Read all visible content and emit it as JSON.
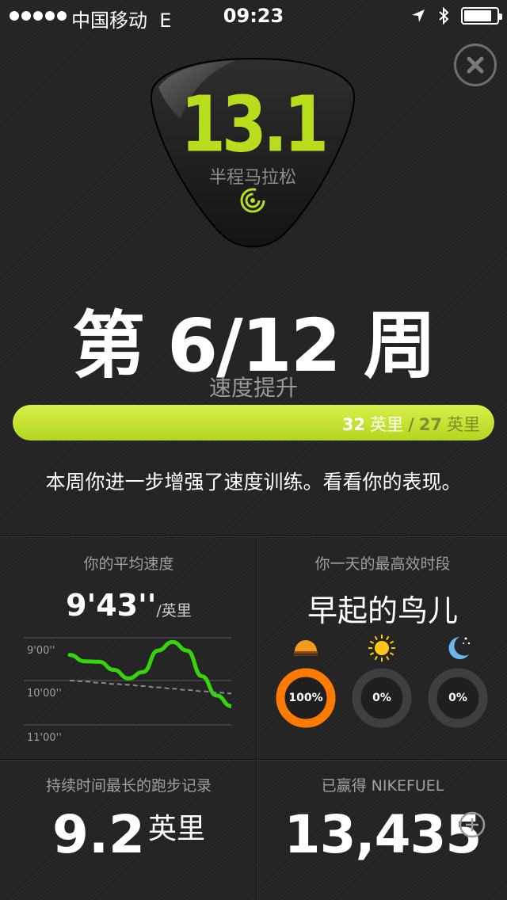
{
  "status_bar": {
    "carrier": "中国移动",
    "network": "E",
    "time": "09:23",
    "battery_level": 0.85
  },
  "badge": {
    "number": "13.1",
    "label": "半程马拉松"
  },
  "week": {
    "title": "第 6/12 周",
    "subtitle": "速度提升"
  },
  "progress": {
    "current_value": "32",
    "current_unit": "英里",
    "separator": "/",
    "goal_value": "27",
    "goal_unit": "英里",
    "fraction": 1.0
  },
  "message": "本周你进一步增强了速度训练。看看你的表现。",
  "average_pace": {
    "label": "你的平均速度",
    "value": "9'43''",
    "unit": "/英里",
    "chart_data": {
      "type": "line",
      "y_tick_labels": [
        "9'00''",
        "10'00''",
        "11'00''"
      ],
      "series": [
        {
          "values": [
            0.4,
            0.55,
            0.56,
            0.75,
            0.95,
            0.8,
            0.3,
            0.1,
            0.3,
            0.9,
            1.35,
            1.6
          ]
        },
        {
          "values": [
            1.0,
            1.02,
            1.05,
            1.08,
            1.1,
            1.13,
            1.16,
            1.19,
            1.22,
            1.25,
            1.28,
            1.3
          ],
          "style": "dashed"
        }
      ]
    }
  },
  "best_time": {
    "label": "你一天的最高效时段",
    "value": "早起的鸟儿",
    "slots": [
      {
        "icon": "sunrise-icon",
        "percent": "100%",
        "fraction": 1.0,
        "color": "#ff7a00"
      },
      {
        "icon": "sun-icon",
        "percent": "0%",
        "fraction": 0.0,
        "color": "#ffcc00"
      },
      {
        "icon": "moon-icon",
        "percent": "0%",
        "fraction": 0.0,
        "color": "#5aa9e6"
      }
    ]
  },
  "longest_run": {
    "label": "持续时间最长的跑步记录",
    "value": "9.2",
    "unit": "英里"
  },
  "nikefuel": {
    "label": "已赢得 NIKEFUEL",
    "value": "13,435"
  },
  "colors": {
    "accent": "#b7dd1d",
    "progress_fill": "#cbe635",
    "chart_line": "#35d40f",
    "ring_active": "#ff7a00",
    "ring_inactive": "#3f3f3f"
  }
}
